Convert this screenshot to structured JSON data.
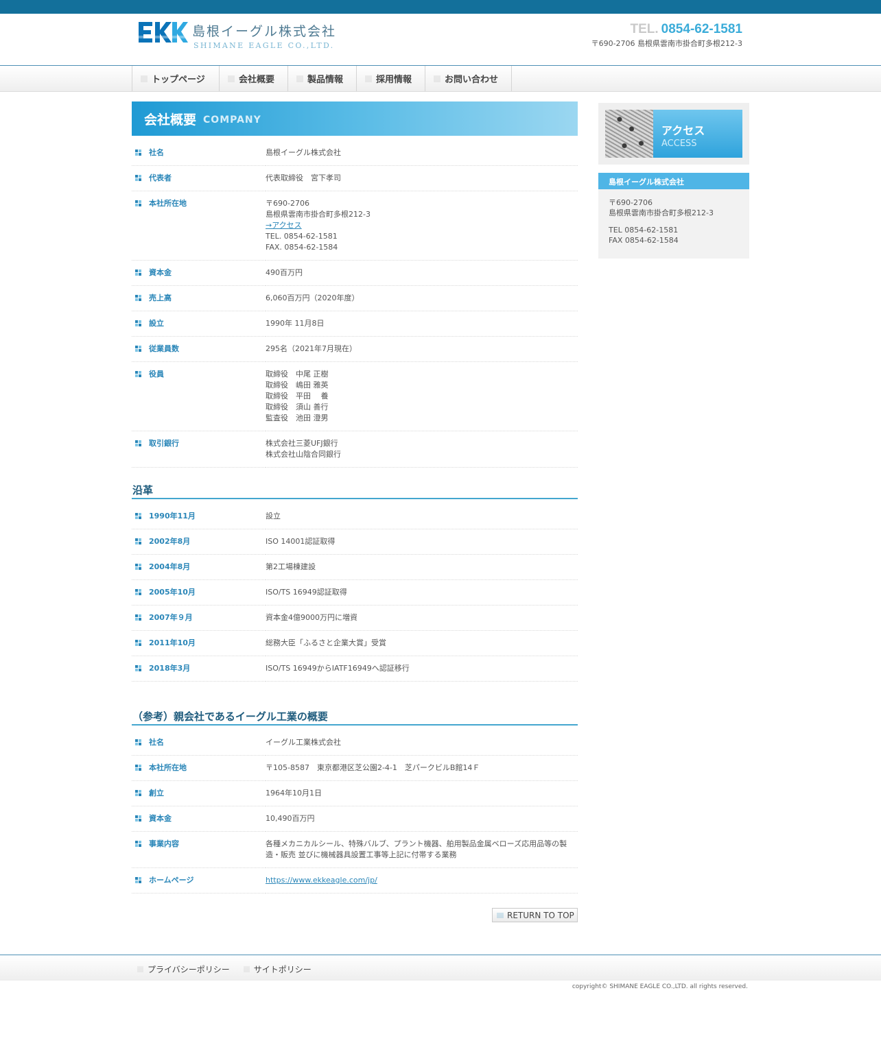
{
  "brand": {
    "logo_text": "EKK",
    "name_jp": "島根イーグル株式会社",
    "name_en": "SHIMANE EAGLE CO.,LTD."
  },
  "header": {
    "tel_prefix": "TEL.",
    "tel_number": "0854-62-1581",
    "address": "〒690-2706 島根県雲南市掛合町多根212-3"
  },
  "nav": [
    {
      "label": "トップページ"
    },
    {
      "label": "会社概要"
    },
    {
      "label": "製品情報"
    },
    {
      "label": "採用情報"
    },
    {
      "label": "お問い合わせ"
    }
  ],
  "page_title": {
    "jp": "会社概要",
    "en": "COMPANY"
  },
  "company": [
    {
      "label": "社名",
      "lines": [
        "島根イーグル株式会社"
      ]
    },
    {
      "label": "代表者",
      "lines": [
        "代表取締役　宮下孝司"
      ]
    },
    {
      "label": "本社所在地",
      "lines": [
        "〒690-2706",
        "島根県雲南市掛合町多根212-3"
      ],
      "link": "→アクセス",
      "after_link": [
        "TEL. 0854-62-1581",
        "FAX. 0854-62-1584"
      ]
    },
    {
      "label": "資本金",
      "lines": [
        "490百万円"
      ]
    },
    {
      "label": "売上高",
      "lines": [
        "6,060百万円（2020年度）"
      ]
    },
    {
      "label": "設立",
      "lines": [
        "1990年 11月8日"
      ]
    },
    {
      "label": "従業員数",
      "lines": [
        "295名（2021年7月現在）"
      ]
    },
    {
      "label": "役員",
      "lines": [
        "取締役　中尾 正樹",
        "取締役　嶋田 雅英",
        "取締役　平田　 養",
        "取締役　須山 善行",
        "監査役　池田 澄男"
      ]
    },
    {
      "label": "取引銀行",
      "lines": [
        "株式会社三菱UFJ銀行",
        "株式会社山陰合同銀行"
      ]
    }
  ],
  "history_title": "沿革",
  "history": [
    {
      "date": "1990年11月",
      "event": "設立"
    },
    {
      "date": "2002年8月",
      "event": "ISO 14001認証取得"
    },
    {
      "date": "2004年8月",
      "event": "第2工場棟建設"
    },
    {
      "date": "2005年10月",
      "event": "ISO/TS 16949認証取得"
    },
    {
      "date": "2007年９月",
      "event": "資本金4億9000万円に増資"
    },
    {
      "date": "2011年10月",
      "event": "総務大臣「ふるさと企業大賞」受賞"
    },
    {
      "date": "2018年3月",
      "event": "ISO/TS 16949からIATF16949へ認証移行"
    }
  ],
  "parent_title": "（参考）親会社であるイーグル工業の概要",
  "parent": [
    {
      "label": "社名",
      "value": "イーグル工業株式会社"
    },
    {
      "label": "本社所在地",
      "value": "〒105-8587　東京都港区芝公園2-4-1　芝パークビルB館14Ｆ"
    },
    {
      "label": "創立",
      "value": "1964年10月1日"
    },
    {
      "label": "資本金",
      "value": "10,490百万円"
    },
    {
      "label": "事業内容",
      "value": "各種メカニカルシール、特殊バルブ、プラント機器、舶用製品金属ベローズ応用品等の製造・販売 並びに機械器具設置工事等上記に付帯する業務"
    },
    {
      "label": "ホームページ",
      "link": "https://www.ekkeagle.com/jp/"
    }
  ],
  "return_top": "RETURN TO TOP",
  "sidebar": {
    "access_jp": "アクセス",
    "access_en": "ACCESS",
    "company_name": "島根イーグル株式会社",
    "postal": "〒690-2706",
    "address": "島根県雲南市掛合町多根212-3",
    "tel": "TEL 0854-62-1581",
    "fax": "FAX 0854-62-1584"
  },
  "footer": {
    "links": [
      {
        "label": "プライバシーポリシー"
      },
      {
        "label": "サイトポリシー"
      }
    ],
    "copyright": "copyright© SHIMANE EAGLE CO.,LTD. all rights reserved."
  },
  "colors": {
    "topbar": "#13709b",
    "accent": "#3bacd9",
    "label_blue": "#2a86b8"
  },
  "icons": [
    "ekk-logo-icon",
    "square-bullet-icon",
    "dotted-grid-icon",
    "return-arrow-icon"
  ]
}
